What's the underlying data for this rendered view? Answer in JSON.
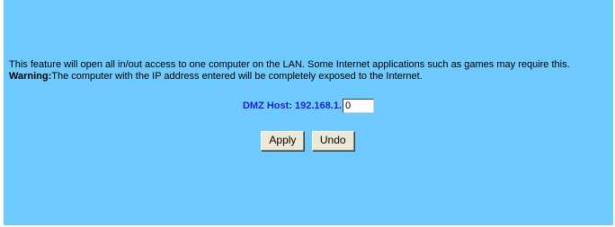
{
  "description": {
    "line1": "This feature will open all in/out access to one computer on the LAN. Some Internet applications such as games may require this.",
    "warning_label": "Warning:",
    "warning_text": "The computer with the IP address entered will be completely exposed to the Internet."
  },
  "dmz": {
    "label": "DMZ Host: 192.168.1.",
    "value": "0"
  },
  "buttons": {
    "apply": "Apply",
    "undo": "Undo"
  },
  "colors": {
    "background": "#6fcaff",
    "label": "#1f24c8"
  }
}
